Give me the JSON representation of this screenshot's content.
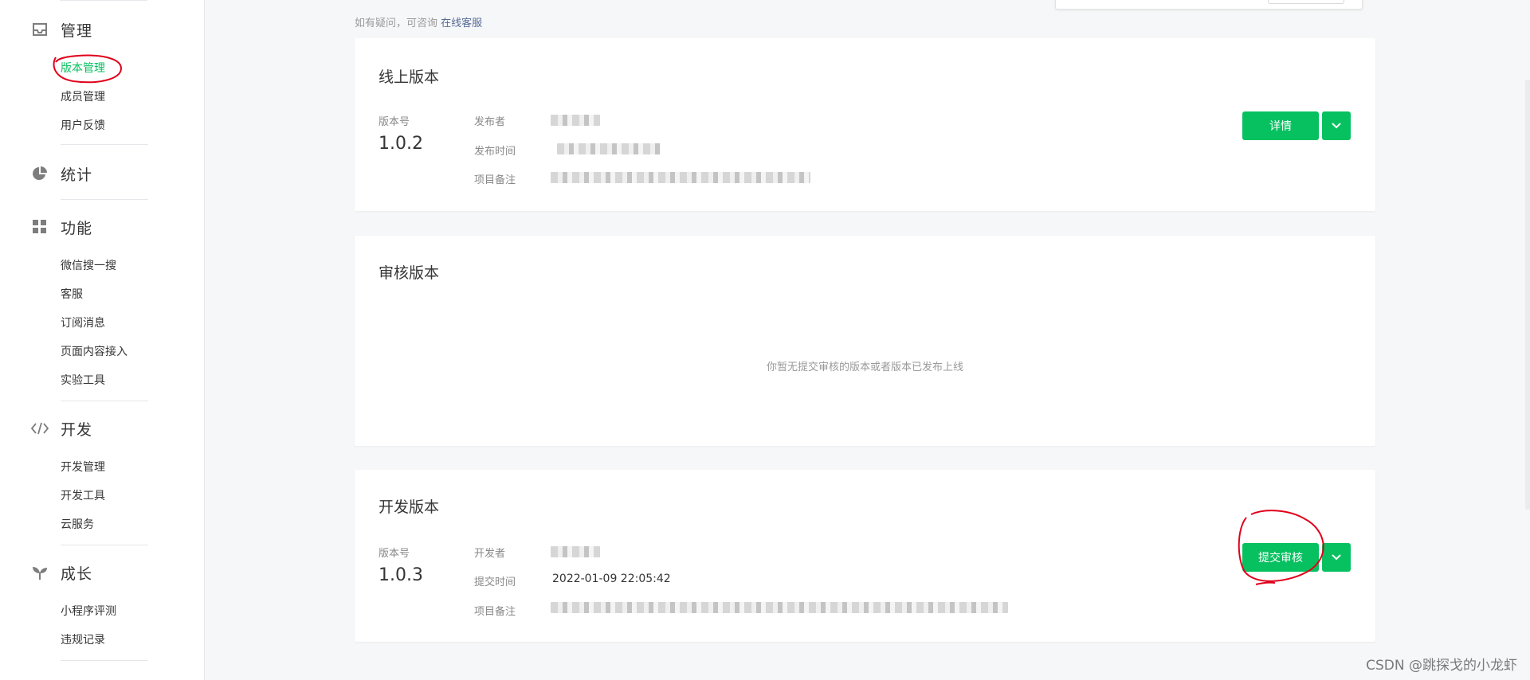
{
  "sidebar": {
    "sections": [
      {
        "title": "管理",
        "icon": "inbox-icon",
        "items": [
          "版本管理",
          "成员管理",
          "用户反馈"
        ]
      },
      {
        "title": "统计",
        "icon": "pie-chart-icon",
        "items": []
      },
      {
        "title": "功能",
        "icon": "grid-icon",
        "items": [
          "微信搜一搜",
          "客服",
          "订阅消息",
          "页面内容接入",
          "实验工具"
        ]
      },
      {
        "title": "开发",
        "icon": "code-icon",
        "items": [
          "开发管理",
          "开发工具",
          "云服务"
        ]
      },
      {
        "title": "成长",
        "icon": "sprout-icon",
        "items": [
          "小程序评测",
          "违规记录"
        ]
      }
    ],
    "active_item": "版本管理"
  },
  "hint": {
    "text": "如有疑问，可咨询",
    "link": "在线客服"
  },
  "online": {
    "title": "线上版本",
    "version_label": "版本号",
    "version": "1.0.2",
    "fields": [
      "发布者",
      "发布时间",
      "项目备注"
    ],
    "detail_button": "详情"
  },
  "review": {
    "title": "审核版本",
    "empty_text": "你暂无提交审核的版本或者版本已发布上线"
  },
  "dev": {
    "title": "开发版本",
    "version_label": "版本号",
    "version": "1.0.3",
    "fields": [
      "开发者",
      "提交时间",
      "项目备注"
    ],
    "submit_time": "2022-01-09 22:05:42",
    "submit_button": "提交审核"
  },
  "watermark": "CSDN @跳探戈的小龙虾",
  "colors": {
    "accent": "#07c160",
    "link": "#576b95",
    "annotation": "#e0001b"
  }
}
